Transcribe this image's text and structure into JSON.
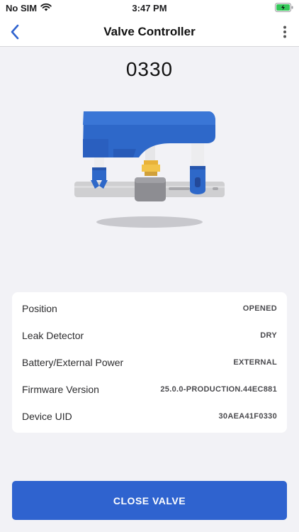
{
  "status_bar": {
    "carrier": "No SIM",
    "time": "3:47 PM"
  },
  "nav": {
    "title": "Valve Controller",
    "back_icon": "chevron-left-icon",
    "more_icon": "vertical-ellipsis-icon"
  },
  "device": {
    "name": "0330"
  },
  "info": {
    "rows": [
      {
        "label": "Position",
        "value": "OPENED"
      },
      {
        "label": "Leak Detector",
        "value": "DRY"
      },
      {
        "label": "Battery/External Power",
        "value": "EXTERNAL"
      },
      {
        "label": "Firmware Version",
        "value": "25.0.0-PRODUCTION.44EC881"
      },
      {
        "label": "Device UID",
        "value": "30AEA41F0330"
      }
    ]
  },
  "action": {
    "label": "CLOSE VALVE"
  },
  "colors": {
    "accent": "#2f63cf",
    "battery": "#34c759",
    "valve_body": "#2e68c9"
  }
}
